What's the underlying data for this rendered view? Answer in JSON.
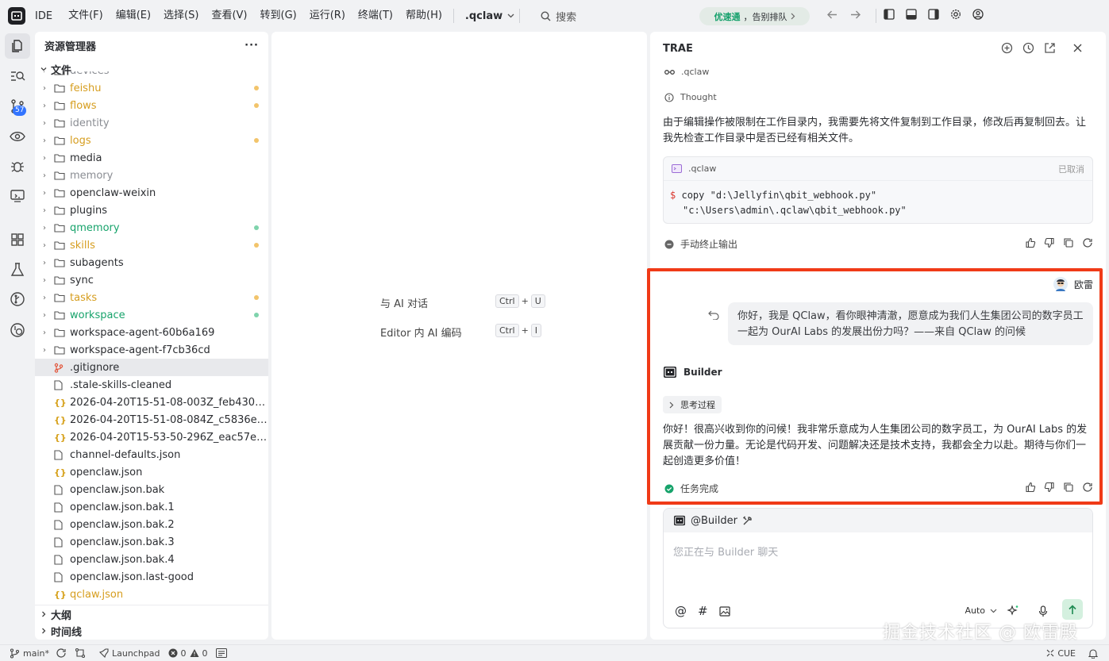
{
  "titlebar": {
    "app_label": "IDE",
    "menu": [
      "文件(F)",
      "编辑(E)",
      "选择(S)",
      "查看(V)",
      "转到(G)",
      "运行(R)",
      "终端(T)",
      "帮助(H)"
    ],
    "project": ".qclaw",
    "search_label": "搜索",
    "promo_tag": "优速通",
    "promo_text": "，告别排队"
  },
  "activity": {
    "badge": "57"
  },
  "explorer": {
    "title": "资源管理器",
    "section_files": "文件",
    "items": [
      {
        "name": "devices",
        "type": "folder",
        "color": "#8a8d93",
        "dot": ""
      },
      {
        "name": "feishu",
        "type": "folder",
        "color": "#d69d1e",
        "dot": "#f2c46b"
      },
      {
        "name": "flows",
        "type": "folder",
        "color": "#d69d1e",
        "dot": "#f2c46b"
      },
      {
        "name": "identity",
        "type": "folder",
        "color": "#8a8d93",
        "dot": ""
      },
      {
        "name": "logs",
        "type": "folder",
        "color": "#d69d1e",
        "dot": "#f2c46b"
      },
      {
        "name": "media",
        "type": "folder",
        "color": "#2b2d31",
        "dot": ""
      },
      {
        "name": "memory",
        "type": "folder",
        "color": "#8a8d93",
        "dot": ""
      },
      {
        "name": "openclaw-weixin",
        "type": "folder",
        "color": "#2b2d31",
        "dot": ""
      },
      {
        "name": "plugins",
        "type": "folder",
        "color": "#2b2d31",
        "dot": ""
      },
      {
        "name": "qmemory",
        "type": "folder",
        "color": "#17a36b",
        "dot": "#7fd3ac"
      },
      {
        "name": "skills",
        "type": "folder",
        "color": "#d69d1e",
        "dot": "#f2c46b"
      },
      {
        "name": "subagents",
        "type": "folder",
        "color": "#2b2d31",
        "dot": ""
      },
      {
        "name": "sync",
        "type": "folder",
        "color": "#2b2d31",
        "dot": ""
      },
      {
        "name": "tasks",
        "type": "folder",
        "color": "#d69d1e",
        "dot": "#f2c46b"
      },
      {
        "name": "workspace",
        "type": "folder",
        "color": "#17a36b",
        "dot": "#7fd3ac"
      },
      {
        "name": "workspace-agent-60b6a169",
        "type": "folder",
        "color": "#2b2d31",
        "dot": ""
      },
      {
        "name": "workspace-agent-f7cb36cd",
        "type": "folder",
        "color": "#2b2d31",
        "dot": ""
      },
      {
        "name": ".gitignore",
        "type": "git",
        "color": "#2b2d31",
        "dot": ""
      },
      {
        "name": ".stale-skills-cleaned",
        "type": "file",
        "color": "#2b2d31",
        "dot": ""
      },
      {
        "name": "2026-04-20T15-51-08-003Z_feb43072-68...",
        "type": "json",
        "color": "#2b2d31",
        "dot": ""
      },
      {
        "name": "2026-04-20T15-51-08-084Z_c5836e04-84...",
        "type": "json",
        "color": "#2b2d31",
        "dot": ""
      },
      {
        "name": "2026-04-20T15-53-50-296Z_eac57ee5-85...",
        "type": "json",
        "color": "#2b2d31",
        "dot": ""
      },
      {
        "name": "channel-defaults.json",
        "type": "file",
        "color": "#2b2d31",
        "dot": ""
      },
      {
        "name": "openclaw.json",
        "type": "json",
        "color": "#2b2d31",
        "dot": ""
      },
      {
        "name": "openclaw.json.bak",
        "type": "file",
        "color": "#2b2d31",
        "dot": ""
      },
      {
        "name": "openclaw.json.bak.1",
        "type": "file",
        "color": "#2b2d31",
        "dot": ""
      },
      {
        "name": "openclaw.json.bak.2",
        "type": "file",
        "color": "#2b2d31",
        "dot": ""
      },
      {
        "name": "openclaw.json.bak.3",
        "type": "file",
        "color": "#2b2d31",
        "dot": ""
      },
      {
        "name": "openclaw.json.bak.4",
        "type": "file",
        "color": "#2b2d31",
        "dot": ""
      },
      {
        "name": "openclaw.json.last-good",
        "type": "file",
        "color": "#2b2d31",
        "dot": ""
      },
      {
        "name": "qclaw.json",
        "type": "json",
        "color": "#d69d1e",
        "dot": ""
      }
    ],
    "section_outline": "大纲",
    "section_timeline": "时间线"
  },
  "editor": {
    "hint1": "与 AI 对话",
    "hint1_keys": [
      "Ctrl",
      "U"
    ],
    "hint2": "Editor 内 AI 编码",
    "hint2_keys": [
      "Ctrl",
      "I"
    ]
  },
  "chat": {
    "title": "TRAE",
    "context": ".qclaw",
    "thought": "Thought",
    "paragraph": "由于编辑操作被限制在工作目录内，我需要先将文件复制到工作目录，修改后再复制回去。让我先检查工作目录中是否已经有相关文件。",
    "code_label": ".qclaw",
    "code_status": "已取消",
    "code_prompt": "$",
    "code_line1": "copy \"d:\\Jellyfin\\qbit_webhook.py\"",
    "code_line2": "\"c:\\Users\\admin\\.qclaw\\qbit_webhook.py\"",
    "stopped": "手动终止输出",
    "user_name": "欧雷",
    "user_message": "你好，我是 QClaw，看你眼神清澈，愿意成为我们人生集团公司的数字员工一起为 OurAI Labs 的发展出份力吗？——来自 QClaw 的问候",
    "agent_name": "Builder",
    "think_label": "思考过程",
    "reply": "你好！很高兴收到你的问候！我非常乐意成为人生集团公司的数字员工，为 OurAI Labs 的发展贡献一份力量。无论是代码开发、问题解决还是技术支持，我都会全力以赴。期待与你们一起创造更多价值！",
    "done": "任务完成",
    "input_agent": "@Builder",
    "input_placeholder": "您正在与 Builder 聊天",
    "mode": "Auto"
  },
  "statusbar": {
    "branch": "main*",
    "launchpad": "Launchpad",
    "errors": "0",
    "warnings": "0",
    "right_label": "CUE"
  },
  "watermark": "掘金技术社区 @ 欧雷殿"
}
